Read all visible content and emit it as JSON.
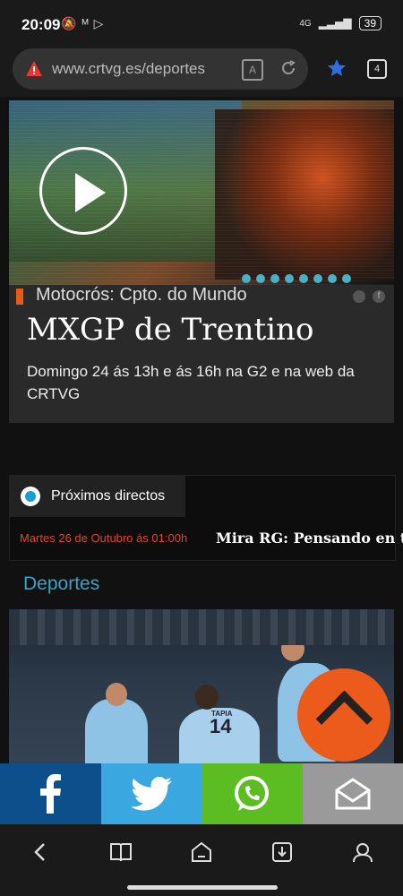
{
  "status_bar": {
    "time": "20:09",
    "network": "4G",
    "battery": "39"
  },
  "browser": {
    "url": "www.crtvg.es/deportes",
    "tab_count": "4",
    "reader_label": "A"
  },
  "featured": {
    "category": "Motocrós: Cpto. do Mundo",
    "title": "MXGP de Trentino",
    "description": "Domingo 24 ás 13h e ás 16h na G2 e na web da CRTVG",
    "slides": 8
  },
  "live": {
    "header": "Próximos directos",
    "date": "Martes 26 de Outubro ás 01:00h",
    "program": "Mira RG: Pensando en ti"
  },
  "section": {
    "title": "Deportes"
  },
  "sports_image": {
    "jersey_number": "14",
    "jersey_name": "TAPIA"
  },
  "colors": {
    "accent_orange": "#ec5a1c",
    "section_blue": "#3aa3c8",
    "live_date_red": "#e0452a",
    "facebook": "#0d4f8a",
    "twitter": "#3aa7e0",
    "whatsapp": "#5bbd21",
    "mail": "#9a9a9a"
  }
}
